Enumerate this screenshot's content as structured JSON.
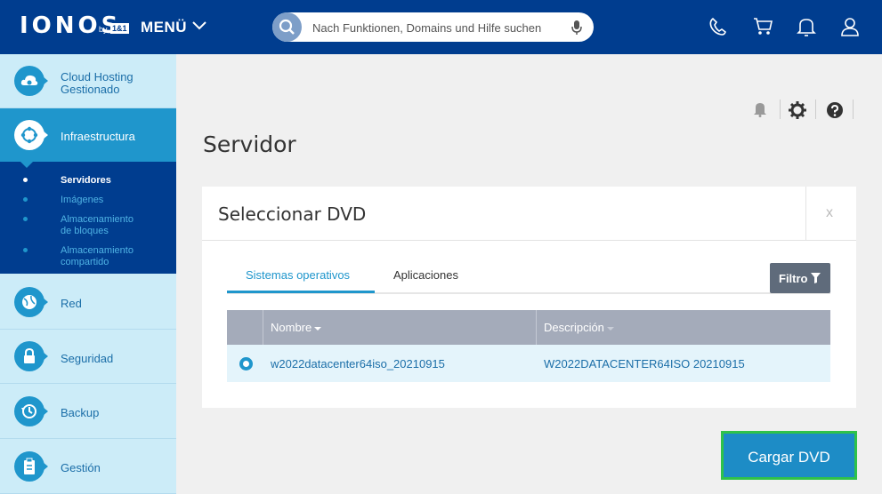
{
  "header": {
    "logo": "IONOS",
    "logo_by": "by",
    "logo_brand": "1&1",
    "menu_label": "MENÜ",
    "search_placeholder": "Nach Funktionen, Domains und Hilfe suchen"
  },
  "sidebar": {
    "items": [
      {
        "label_line1": "Cloud Hosting",
        "label_line2": "Gestionado",
        "icon": "cloud-gear-icon"
      },
      {
        "label": "Infraestructura",
        "icon": "infrastructure-icon",
        "active": true
      },
      {
        "label": "Red",
        "icon": "network-globe-icon"
      },
      {
        "label": "Seguridad",
        "icon": "lock-icon"
      },
      {
        "label": "Backup",
        "icon": "backup-clock-icon"
      },
      {
        "label": "Gestión",
        "icon": "clipboard-icon"
      }
    ],
    "subitems": [
      {
        "label": "Servidores",
        "active": true
      },
      {
        "label": "Imágenes"
      },
      {
        "label_line1": "Almacenamiento",
        "label_line2": "de bloques"
      },
      {
        "label_line1": "Almacenamiento",
        "label_line2": "compartido"
      }
    ]
  },
  "main": {
    "title": "Servidor",
    "panel": {
      "title": "Seleccionar DVD",
      "close": "x",
      "tabs": [
        {
          "label": "Sistemas operativos",
          "active": true
        },
        {
          "label": "Aplicaciones"
        }
      ],
      "filter_label": "Filtro",
      "columns": [
        "Nombre",
        "Descripción"
      ],
      "rows": [
        {
          "name": "w2022datacenter64iso_20210915",
          "description": "W2022DATACENTER64ISO 20210915",
          "selected": true
        }
      ]
    },
    "action_button": "Cargar DVD"
  },
  "colors": {
    "header_bg": "#003d8f",
    "accent": "#1f96cc",
    "sidebar_bg": "#ccecf8",
    "highlight_border": "#2fc24a"
  }
}
